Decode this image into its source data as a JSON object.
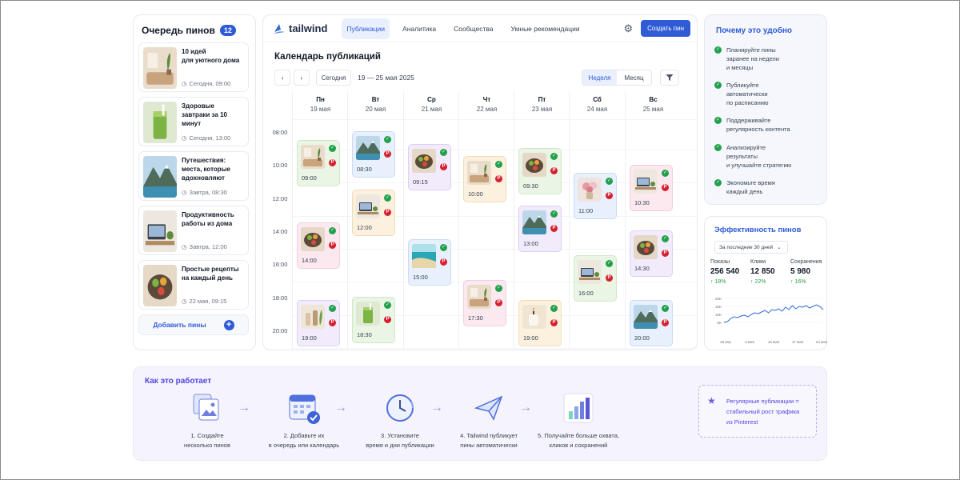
{
  "queue": {
    "title": "Очередь пинов",
    "count": "12",
    "items": [
      {
        "name": "10 идей\nдля уютного дома",
        "time": "Сегодня, 09:00",
        "thumb": "interior"
      },
      {
        "name": "Здоровые\nзавтраки за 10 минут",
        "time": "Сегодня, 13:00",
        "thumb": "smoothie"
      },
      {
        "name": "Путешествия:\nместа, которые\nвдохновляют",
        "time": "Завтра, 08:30",
        "thumb": "mountains"
      },
      {
        "name": "Продуктивность\nработы из дома",
        "time": "Завтра, 12:00",
        "thumb": "desk"
      },
      {
        "name": "Простые рецепты\nна каждый день",
        "time": "22 мая, 09:15",
        "thumb": "bowl"
      }
    ],
    "add_label": "Добавить пины"
  },
  "nav": {
    "brand": "tailwind",
    "tabs": [
      "Публикации",
      "Аналитика",
      "Сообщества",
      "Умные рекомендации"
    ],
    "create_label": "Создать пин"
  },
  "calendar": {
    "title": "Календарь публикаций",
    "today_label": "Сегодня",
    "range": "19 — 25 мая 2025",
    "view_week": "Неделя",
    "view_month": "Месяц",
    "days": [
      {
        "name": "Пн",
        "date": "19 мая"
      },
      {
        "name": "Вт",
        "date": "20 мая"
      },
      {
        "name": "Ср",
        "date": "21 мая"
      },
      {
        "name": "Чт",
        "date": "22 мая"
      },
      {
        "name": "Пт",
        "date": "23 мая"
      },
      {
        "name": "Сб",
        "date": "24 мая"
      },
      {
        "name": "Вс",
        "date": "25 мая"
      }
    ],
    "hours": [
      "08:00",
      "10:00",
      "12:00",
      "14:00",
      "16:00",
      "18:00",
      "20:00"
    ],
    "events": [
      {
        "day": 0,
        "time": "09:00",
        "color": "green",
        "thumb": "interior"
      },
      {
        "day": 0,
        "time": "14:00",
        "color": "pink",
        "thumb": "bowl"
      },
      {
        "day": 0,
        "time": "19:00",
        "color": "purple",
        "thumb": "bottles"
      },
      {
        "day": 1,
        "time": "08:30",
        "color": "blue",
        "thumb": "mountains"
      },
      {
        "day": 1,
        "time": "12:00",
        "color": "orange",
        "thumb": "desk"
      },
      {
        "day": 1,
        "time": "18:30",
        "color": "green",
        "thumb": "smoothie"
      },
      {
        "day": 2,
        "time": "09:15",
        "color": "purple",
        "thumb": "bowl"
      },
      {
        "day": 2,
        "time": "15:00",
        "color": "blue",
        "thumb": "sea"
      },
      {
        "day": 3,
        "time": "10:00",
        "color": "orange",
        "thumb": "interior"
      },
      {
        "day": 3,
        "time": "17:30",
        "color": "pink",
        "thumb": "interior"
      },
      {
        "day": 4,
        "time": "09:30",
        "color": "green",
        "thumb": "bowl"
      },
      {
        "day": 4,
        "time": "13:00",
        "color": "purple",
        "thumb": "mountains"
      },
      {
        "day": 4,
        "time": "19:00",
        "color": "orange",
        "thumb": "candle"
      },
      {
        "day": 5,
        "time": "11:00",
        "color": "blue",
        "thumb": "flowers"
      },
      {
        "day": 5,
        "time": "16:00",
        "color": "green",
        "thumb": "desk"
      },
      {
        "day": 6,
        "time": "10:30",
        "color": "pink",
        "thumb": "desk"
      },
      {
        "day": 6,
        "time": "14:30",
        "color": "purple",
        "thumb": "bowl"
      },
      {
        "day": 6,
        "time": "20:00",
        "color": "blue",
        "thumb": "mountains"
      }
    ]
  },
  "why": {
    "title": "Почему это удобно",
    "items": [
      "Планируйте пины\nзаранее на недели\nи месяцы",
      "Публикуйте\nавтоматически\nпо расписанию",
      "Поддерживайте\nрегулярность контента",
      "Анализируйте\nрезультаты\nи улучшайте стратегию",
      "Экономьте время\nкаждый день"
    ]
  },
  "efficiency": {
    "title": "Эффективность пинов",
    "period": "За последние 30 дней",
    "stats": [
      {
        "label": "Показы",
        "value": "256 540",
        "delta": "↑ 18%"
      },
      {
        "label": "Клики",
        "value": "12 850",
        "delta": "↑ 22%"
      },
      {
        "label": "Сохранения",
        "value": "5 980",
        "delta": "↑ 16%"
      }
    ]
  },
  "chart_data": {
    "type": "line",
    "title": "",
    "xlabel": "",
    "ylabel": "",
    "x": [
      "26 апр",
      "3 мая",
      "10 мая",
      "17 мая",
      "24 мая"
    ],
    "y_ticks": [
      "20K",
      "15K",
      "10K",
      "5K"
    ],
    "ylim": [
      0,
      20000
    ],
    "series": [
      {
        "values": [
          5000,
          5500,
          7500,
          8500,
          8000,
          9000,
          9500,
          8500,
          10000,
          11000,
          10500,
          11500,
          12500,
          11000,
          13000,
          12500,
          13500,
          12000,
          14500,
          13000,
          15500,
          13500,
          15000,
          14500,
          15500,
          14000,
          15000,
          16000,
          15000,
          13000
        ]
      }
    ],
    "color": "#2f6bd6"
  },
  "how": {
    "title": "Как это работает",
    "steps": [
      "1. Создайте\nнесколько пинов",
      "2. Добавьте их\nв очередь или календарь",
      "3. Установите\nвремя и дни публикации",
      "4. Tailwind публикует\nпины автоматически",
      "5. Получайте больше охвата,\nкликов и сохранений"
    ],
    "promo": "Регулярные публикации =\nстабильный рост трафика\nиз Pinterest"
  },
  "colors": {
    "accent": "#2f5bd6",
    "success": "#22a04b",
    "pinterest": "#d6202f",
    "how_accent": "#4f46e5"
  }
}
